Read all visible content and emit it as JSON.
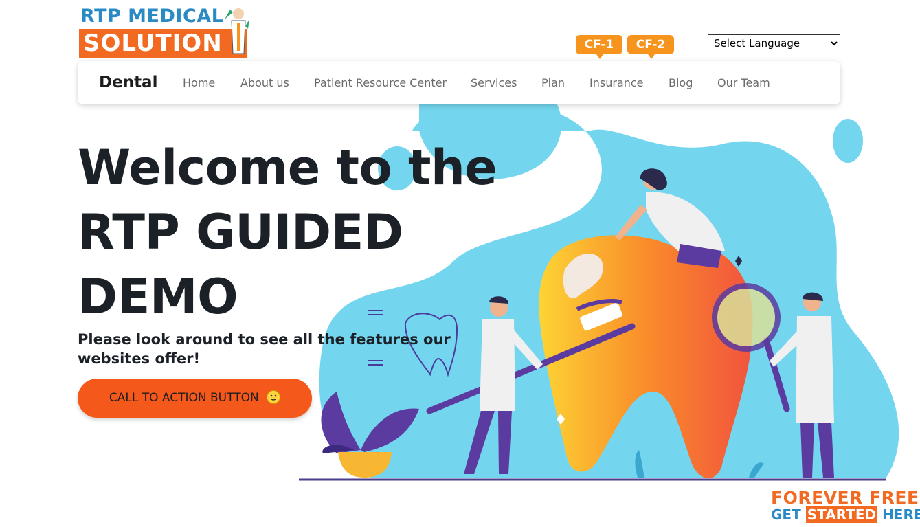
{
  "logo": {
    "line1": "RTP MEDICAL",
    "line2": "SOLUTION"
  },
  "badges": {
    "cf1": "CF-1",
    "cf2": "CF-2"
  },
  "language": {
    "selected": "Select Language"
  },
  "nav": {
    "brand": "Dental",
    "items": [
      "Home",
      "About us",
      "Patient Resource Center",
      "Services",
      "Plan",
      "Insurance",
      "Blog",
      "Our Team"
    ]
  },
  "hero": {
    "title_line1": "Welcome to the",
    "title_line2": "RTP GUIDED",
    "title_line3": "DEMO",
    "subtitle": "Please look around to see all the features our websites offer!",
    "cta_label": "CALL TO ACTION BUTTON"
  },
  "promo": {
    "line1": "FOREVER FREE",
    "line2_a": "GET",
    "line2_b": "STARTED",
    "line2_c": "HERE"
  },
  "colors": {
    "accent_orange": "#f4581a",
    "logo_blue": "#2a8bc4",
    "blob_blue": "#6dd3ec",
    "purple": "#5b3ba0"
  }
}
